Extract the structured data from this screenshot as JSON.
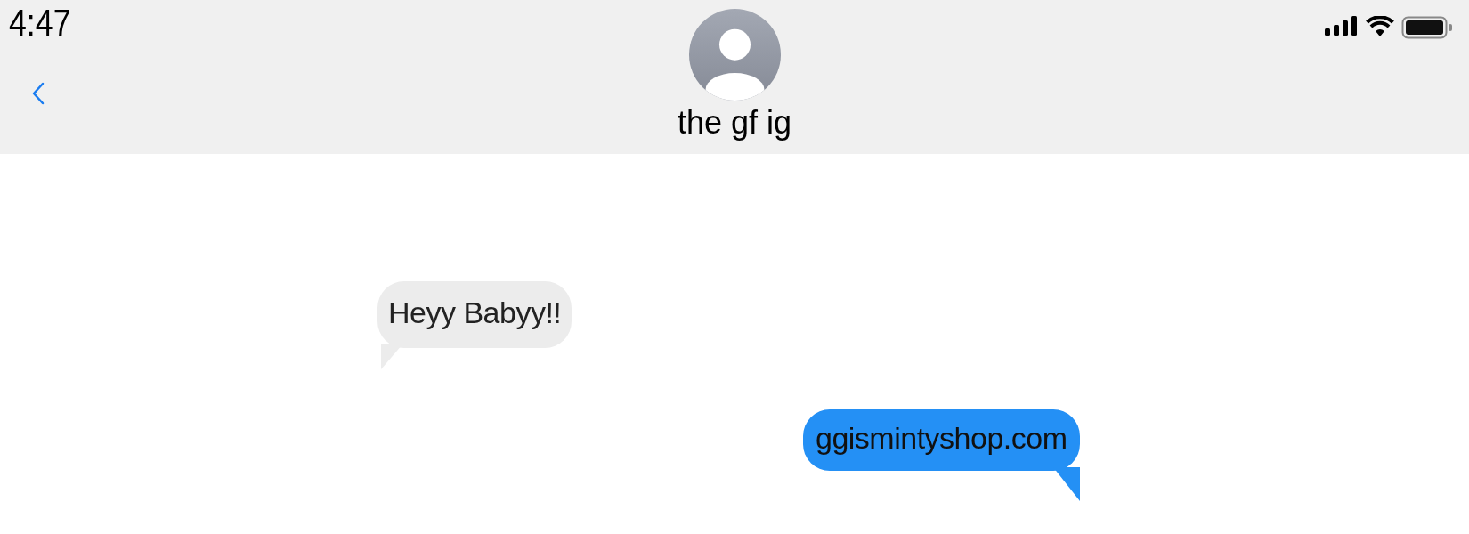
{
  "status_bar": {
    "time": "4:47"
  },
  "header": {
    "contact_name": "the gf ig"
  },
  "messages": [
    {
      "kind": "received",
      "text": "Heyy Babyy!!"
    },
    {
      "kind": "sent",
      "text": "ggismintyshop.com"
    }
  ]
}
